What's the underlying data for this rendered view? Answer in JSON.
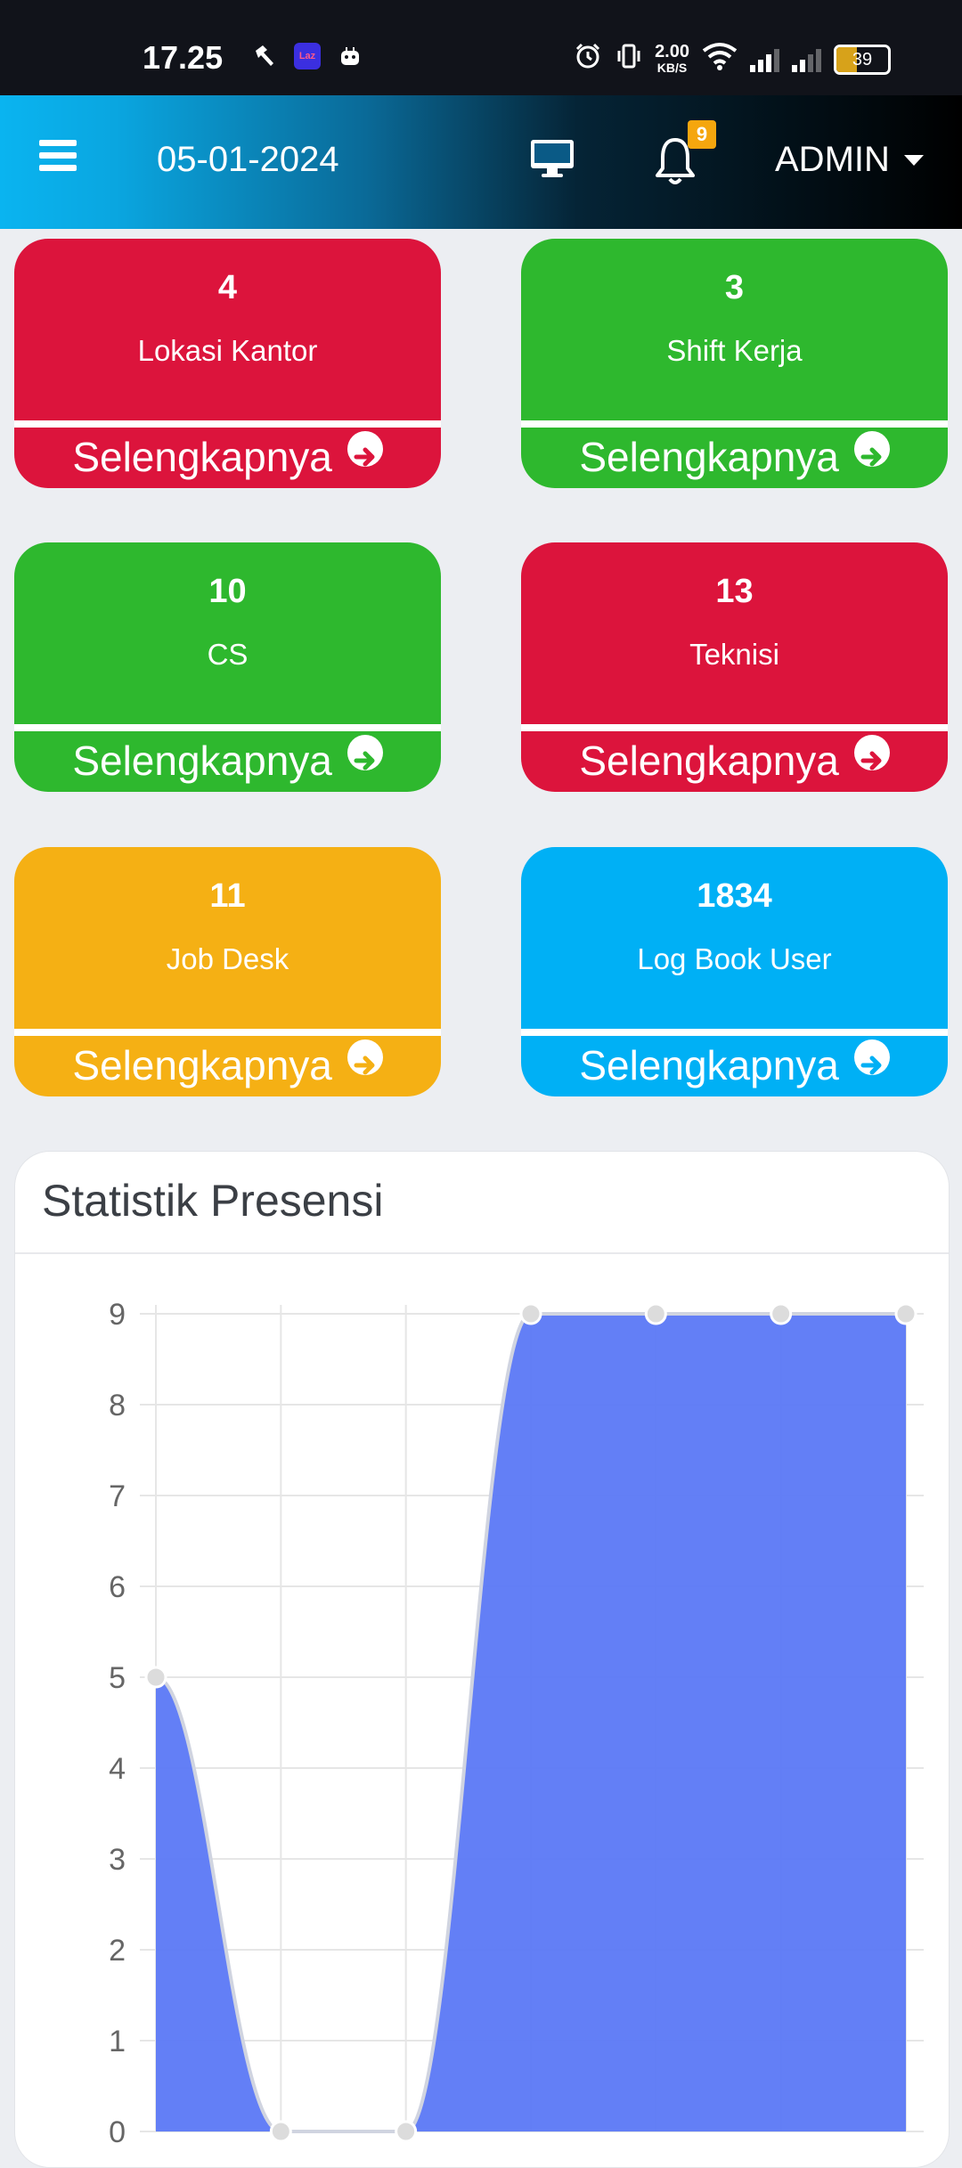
{
  "status_bar": {
    "time": "17.25",
    "speed_value": "2.00",
    "speed_unit": "KB/S",
    "battery": "39",
    "icons": [
      "hammer-icon",
      "lazada-icon",
      "bot-icon",
      "alarm-icon",
      "vibrate-icon",
      "wifi-icon",
      "signal-icon",
      "signal-icon"
    ]
  },
  "navbar": {
    "date": "05-01-2024",
    "notification_count": "9",
    "user": "ADMIN",
    "gradient_start": "#0ab4f0",
    "gradient_end": "#000000"
  },
  "cards": [
    {
      "count": "4",
      "label": "Lokasi Kantor",
      "more": "Selengkapnya",
      "color": "#dc143c"
    },
    {
      "count": "3",
      "label": "Shift Kerja",
      "more": "Selengkapnya",
      "color": "#2eb82e"
    },
    {
      "count": "10",
      "label": "CS",
      "more": "Selengkapnya",
      "color": "#2eb82e"
    },
    {
      "count": "13",
      "label": "Teknisi",
      "more": "Selengkapnya",
      "color": "#dc143c"
    },
    {
      "count": "11",
      "label": "Job Desk",
      "more": "Selengkapnya",
      "color": "#f5b014"
    },
    {
      "count": "1834",
      "label": "Log Book User",
      "more": "Selengkapnya",
      "color": "#00b0f5"
    }
  ],
  "statistik": {
    "title": "Statistik Presensi"
  },
  "chart_data": {
    "type": "area",
    "title": "",
    "xlabel": "",
    "ylabel": "",
    "x": [
      0,
      1,
      2,
      3,
      4,
      5,
      6
    ],
    "series": [
      {
        "values": [
          5,
          0,
          0,
          9,
          9,
          9,
          9
        ],
        "color": "#5b78f5"
      }
    ],
    "ylim": [
      0,
      9
    ],
    "yticks": [
      "0",
      "1",
      "2",
      "3",
      "4",
      "5",
      "6",
      "7",
      "8",
      "9"
    ],
    "grid": true
  }
}
